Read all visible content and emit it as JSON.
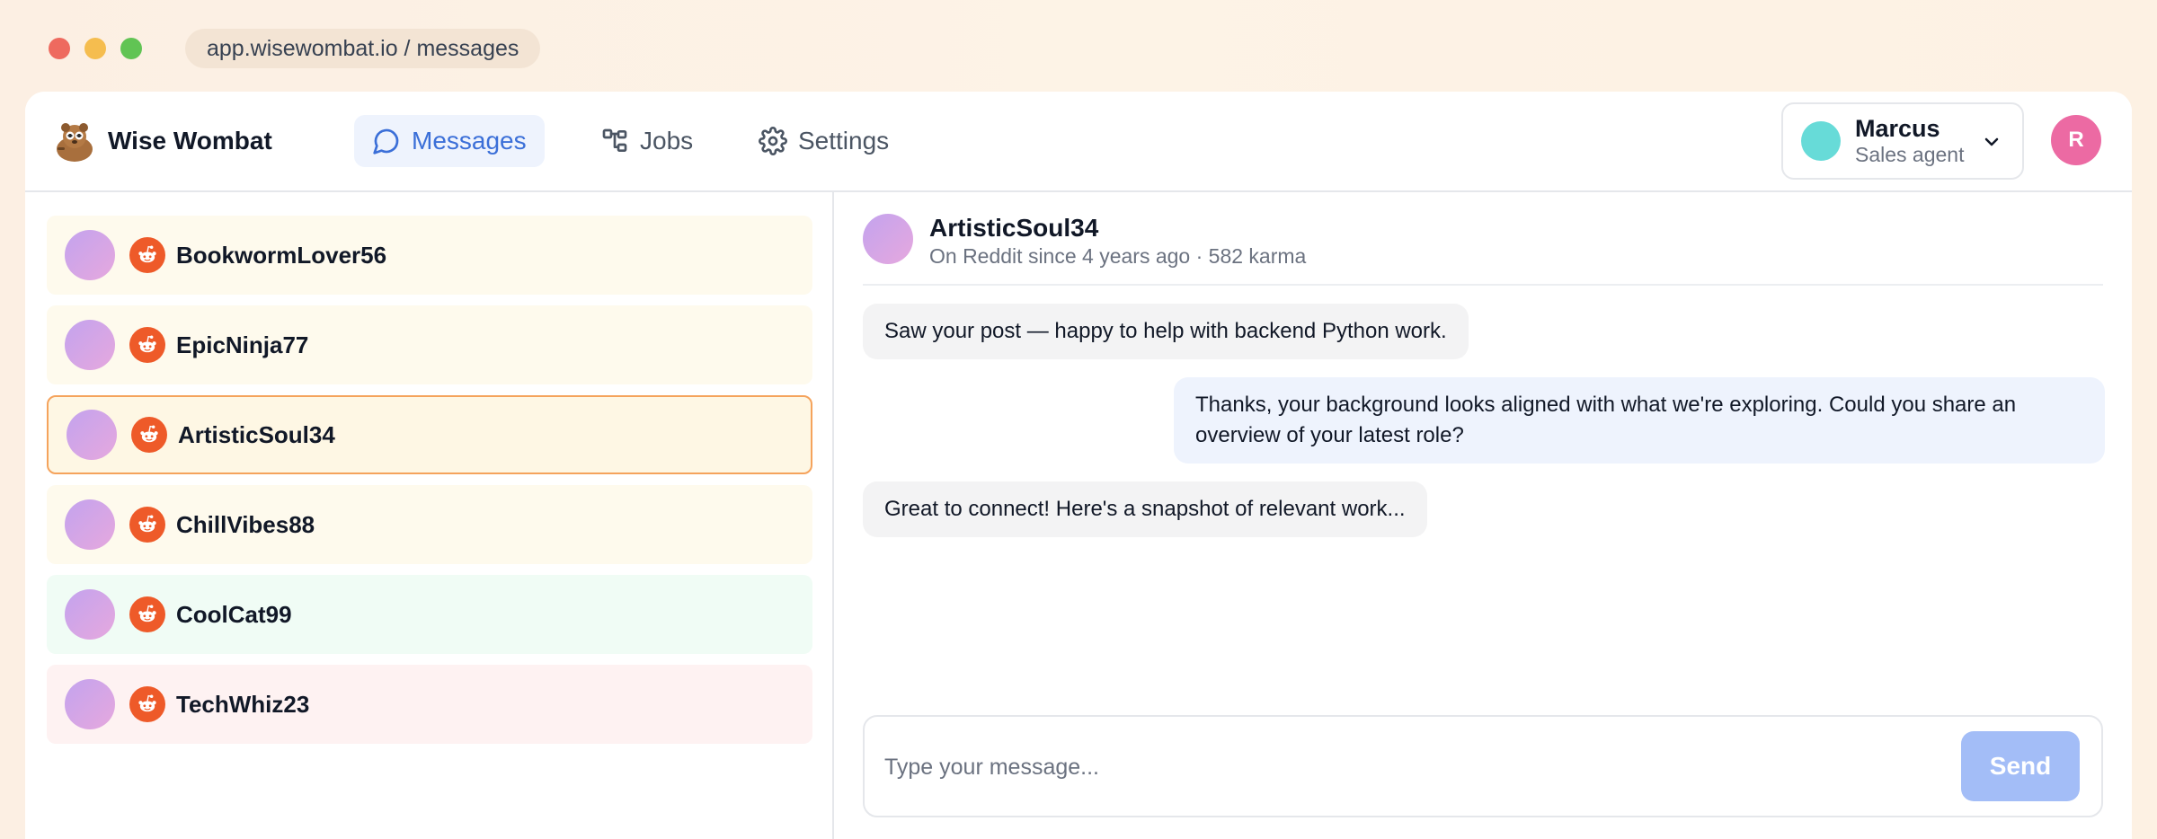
{
  "browser": {
    "url": "app.wisewombat.io / messages"
  },
  "brand": {
    "name": "Wise Wombat",
    "logo_icon": "wombat-logo-icon"
  },
  "nav": {
    "messages": "Messages",
    "jobs": "Jobs",
    "settings": "Settings"
  },
  "user": {
    "name": "Marcus",
    "role": "Sales agent",
    "avatar_initial": "R",
    "status_color": "#67dbd8",
    "avatar_color": "#ec6aa3"
  },
  "conversations": [
    {
      "name": "BookwormLover56",
      "tone": "amber",
      "platform": "reddit-icon"
    },
    {
      "name": "EpicNinja77",
      "tone": "amber",
      "platform": "reddit-icon"
    },
    {
      "name": "ArtisticSoul34",
      "tone": "selected",
      "platform": "reddit-icon"
    },
    {
      "name": "ChillVibes88",
      "tone": "amber",
      "platform": "reddit-icon"
    },
    {
      "name": "CoolCat99",
      "tone": "mint",
      "platform": "reddit-icon"
    },
    {
      "name": "TechWhiz23",
      "tone": "rose",
      "platform": "reddit-icon"
    }
  ],
  "chat": {
    "title": "ArtisticSoul34",
    "subtitle": "On Reddit since 4 years ago · 582 karma",
    "messages": [
      {
        "direction": "in",
        "text": "Saw your post — happy to help with backend Python work."
      },
      {
        "direction": "out",
        "text": "Thanks, your background looks aligned with what we're exploring. Could you share an overview of your latest role?"
      },
      {
        "direction": "in",
        "text": "Great to connect! Here's a snapshot of relevant work..."
      }
    ],
    "composer_placeholder": "Type your message...",
    "send_label": "Send"
  },
  "colors": {
    "accent": "#3b6fd8",
    "reddit": "#ee5a29",
    "send_disabled": "#a3bdf7",
    "selected_border": "#f5a35c"
  }
}
